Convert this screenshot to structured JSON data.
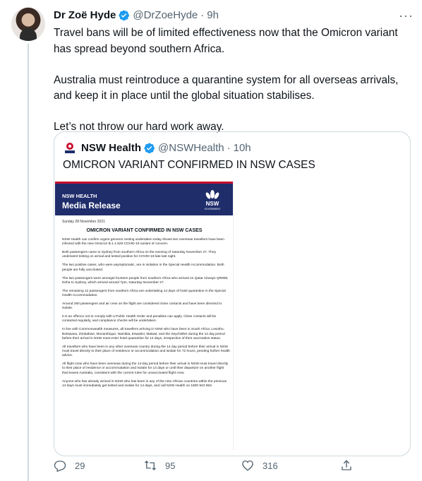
{
  "tweet": {
    "author_name": "Dr Zoë Hyde",
    "author_handle": "@DrZoeHyde",
    "separator": "·",
    "time": "9h",
    "paragraphs": [
      "Travel bans will be of limited effectiveness now that the Omicron variant has spread beyond southern Africa.",
      "Australia must reintroduce a quarantine system for all overseas arrivals, and keep it in place until the global situation stabilises.",
      "Let’s not throw our hard work away."
    ],
    "more_icon": "more-icon"
  },
  "quote": {
    "author_name": "NSW Health",
    "author_handle": "@NSWHealth",
    "separator": "·",
    "time": "10h",
    "text": "OMICRON VARIANT CONFIRMED IN NSW CASES",
    "document": {
      "kicker": "NSW HEALTH",
      "title": "Media Release",
      "logo_text": "NSW",
      "logo_subtext": "GOVERNMENT",
      "date": "Sunday 28 November 2021",
      "heading": "OMICRON VARIANT CONFIRMED IN NSW CASES",
      "paragraphs": [
        "NSW Health can confirm urgent genomic testing undertaken today shows two overseas travellers have been infected with the new Omicron B.1.1.529 COVID-19 variant of concern.",
        "Both passengers came to Sydney from southern Africa on the evening of Saturday November 27. They underwent testing on arrival and tested positive for COVID-19 late last night.",
        "The two positive cases, who were asymptomatic, are in isolation in the Special Health Accommodation. Both people are fully vaccinated.",
        "The two passengers were amongst fourteen people from southern Africa who arrived on Qatar Airways QR908, Doha to Sydney, which arrived around 7pm, Saturday November 27.",
        "The remaining 12 passengers from southern Africa are undertaking 14 days of hotel quarantine in the Special Health Accommodation.",
        "Around 260 passengers and air crew on the flight are considered close contacts and have been directed to isolate.",
        "It is an offence not to comply with a Public Health Order and penalties can apply. Close contacts will be contacted regularly, and compliance checks will be undertaken.",
        "In line with Commonwealth measures, all travellers arriving in NSW who have been in South Africa, Lesotho, Botswana, Zimbabwe, Mozambique, Namibia, Eswatini, Malawi, and the Seychelles during the 14 day period before their arrival in NSW must enter hotel quarantine for 14 days, irrespective of their vaccination status.",
        "All travellers who have been in any other overseas country during the 14 day period before their arrival in NSW must travel directly to their place of residence or accommodation and isolate for 72 hours, pending further health advice.",
        "All flight crew who have been overseas during the 14-day period before their arrival in NSW must travel directly to their place of residence or accommodation and isolate for 14 days or until their departure on another flight that leaves Australia, consistent with the current rules for unvaccinated flight crew.",
        "Anyone who has already arrived in NSW who has been in any of the nine African countries within the previous 14 days must immediately get tested and isolate for 14 days, and call NSW Health on 1800 943 553."
      ]
    }
  },
  "actions": {
    "reply_count": "29",
    "retweet_count": "95",
    "like_count": "316"
  },
  "colors": {
    "verified": "#1d9bf0",
    "nsw_navy": "#1f2d6b",
    "nsw_red": "#c8102e",
    "muted": "#536471"
  }
}
